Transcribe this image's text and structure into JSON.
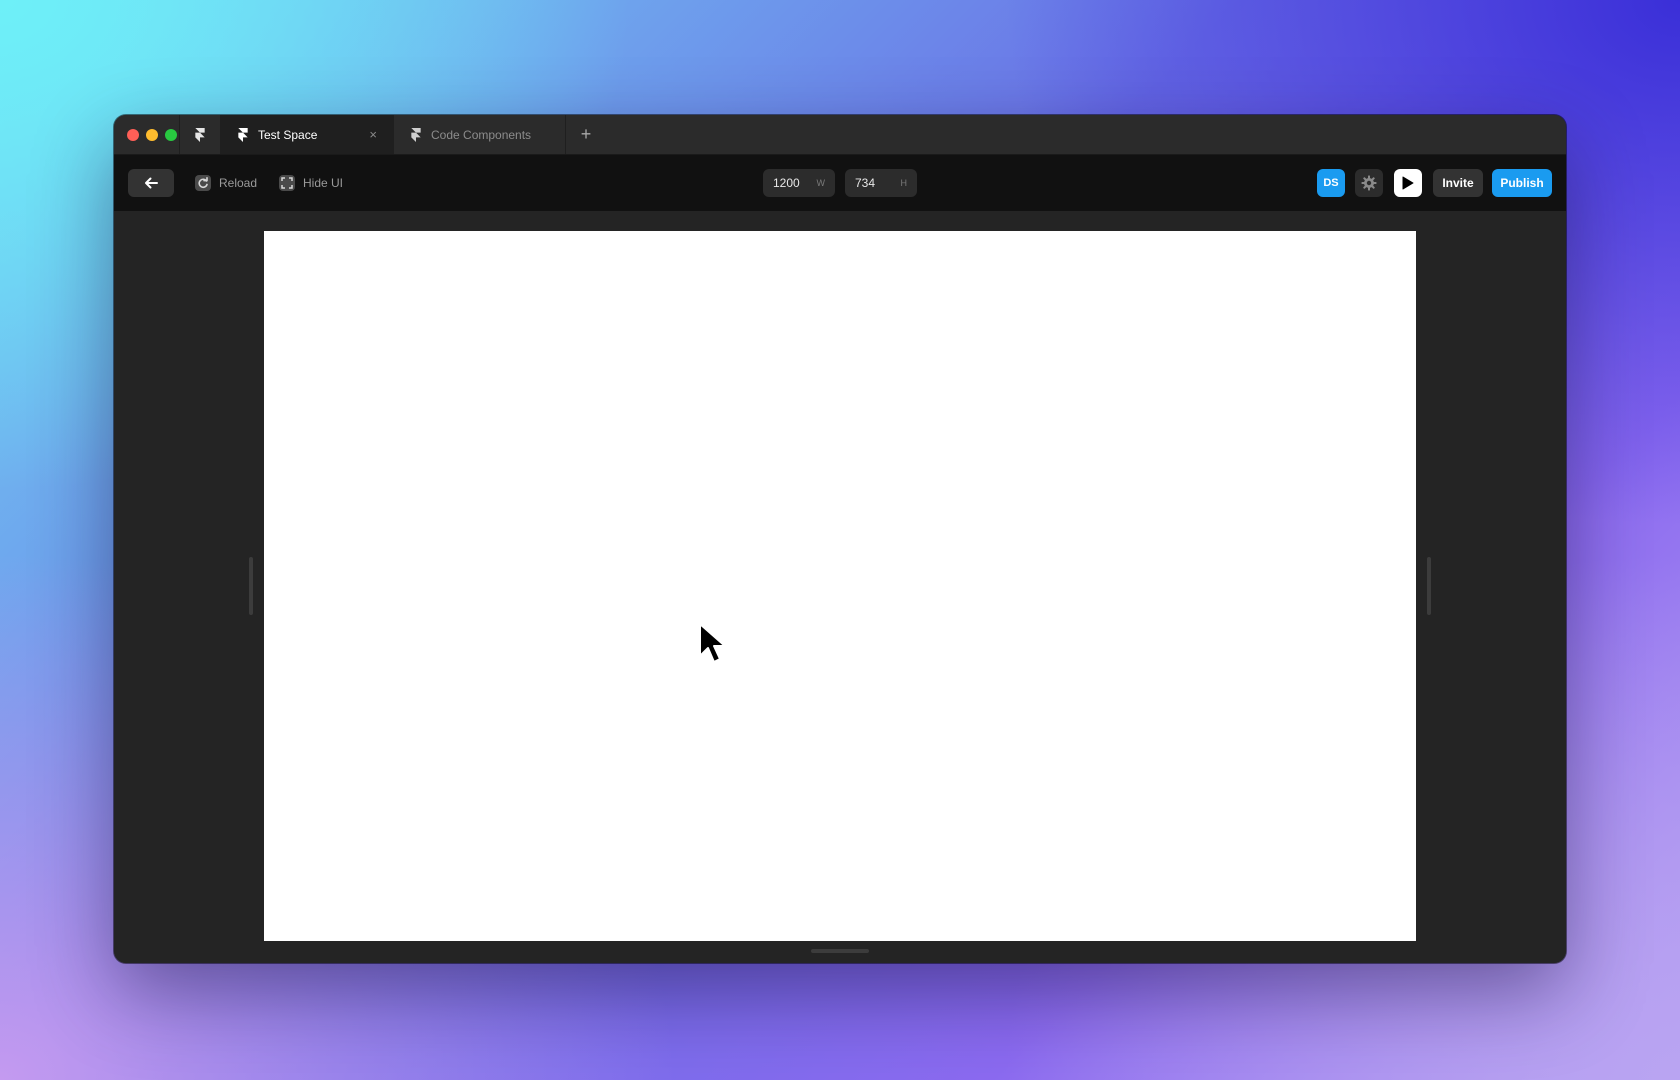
{
  "tabs": [
    {
      "label": "Test Space",
      "active": true,
      "close_glyph": "×"
    },
    {
      "label": "Code Components",
      "active": false
    }
  ],
  "new_tab_glyph": "+",
  "toolbar": {
    "reload_label": "Reload",
    "hide_ui_label": "Hide UI",
    "width_value": "1200",
    "width_unit": "W",
    "height_value": "734",
    "height_unit": "H",
    "avatar_initials": "DS",
    "invite_label": "Invite",
    "publish_label": "Publish"
  },
  "icons": {
    "back": "arrow-left-icon",
    "reload": "reload-icon",
    "hide_ui": "hide-ui-icon",
    "settings": "gear-icon",
    "preview": "play-icon",
    "app": "framer-logo-icon"
  },
  "colors": {
    "accent": "#1a9bf0",
    "toolbar_bg": "#111111",
    "tabbar_bg": "#2b2b2b",
    "canvas_bg": "#ffffff"
  }
}
